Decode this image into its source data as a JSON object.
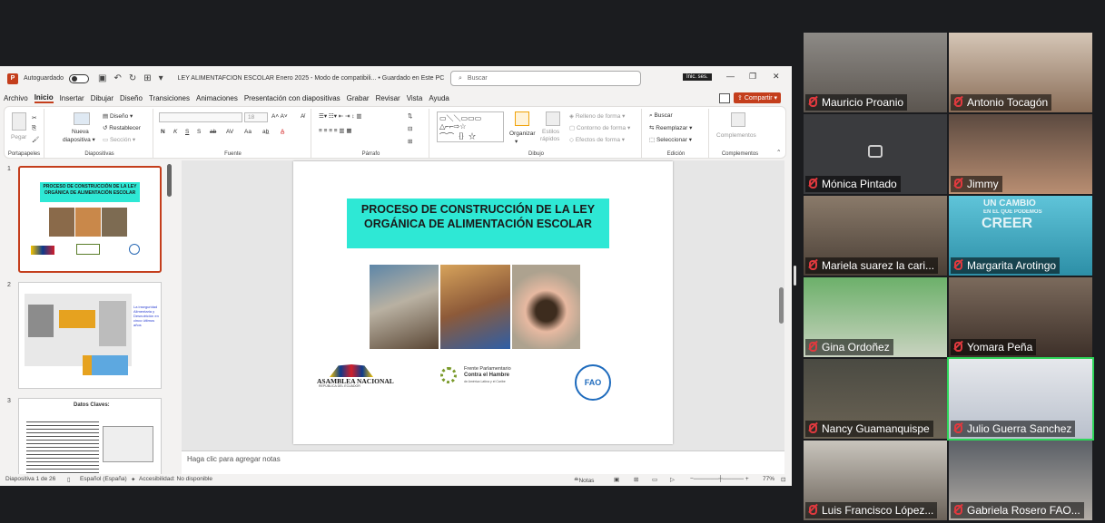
{
  "ppt": {
    "autosave_label": "Autoguardado",
    "doc_title": "LEY ALIMENTAFCION ESCOLAR Enero 2025  -  Modo de compatibili...  •  Guardado en Este PC",
    "search_placeholder": "Buscar",
    "signin": "Inic. ses.",
    "share": "Compartir",
    "menu": [
      "Archivo",
      "Inicio",
      "Insertar",
      "Dibujar",
      "Diseño",
      "Transiciones",
      "Animaciones",
      "Presentación con diapositivas",
      "Grabar",
      "Revisar",
      "Vista",
      "Ayuda"
    ],
    "ribbon": {
      "paste": "Pegar",
      "portapapeles": "Portapapeles",
      "nueva": "Nueva",
      "diapositiva": "diapositiva",
      "diseno": "Diseño",
      "restablecer": "Restablecer",
      "seccion": "Sección",
      "diapositivas": "Diapositivas",
      "fuente": "Fuente",
      "parrafo": "Párrafo",
      "organizar": "Organizar",
      "estilos": "Estilos",
      "rapidos": "rápidos",
      "relleno": "Relleno de forma",
      "contorno": "Contorno de forma",
      "efectos": "Efectos de forma",
      "dibujo": "Dibujo",
      "buscar": "Buscar",
      "reemplazar": "Reemplazar",
      "seleccionar": "Seleccionar",
      "edicion": "Edición",
      "complementos": "Complementos",
      "font_size": "18"
    },
    "thumbnails": [
      {
        "num": "1",
        "title": "PROCESO DE CONSTRUCCIÓN DE LA LEY ORGÁNICA DE ALIMENTACIÓN ESCOLAR"
      },
      {
        "num": "2",
        "side_text": "La inseguridad Alimentaria y Desnutrición en cinco últimos años"
      },
      {
        "num": "3",
        "title": "Datos Claves:"
      }
    ],
    "slide": {
      "title": "PROCESO DE CONSTRUCCIÓN DE LA LEY ORGÁNICA DE ALIMENTACIÓN ESCOLAR",
      "logo_asamblea": "ASAMBLEA NACIONAL",
      "logo_asamblea_sub": "REPÚBLICA DEL ECUADOR",
      "logo_frente_1": "Frente Parlamentario",
      "logo_frente_2": "Contra el Hambre",
      "logo_frente_3": "de América Latina y el Caribe",
      "logo_fao": "FAO"
    },
    "notes_placeholder": "Haga clic para agregar notas",
    "status": {
      "slide": "Diapositiva 1 de 26",
      "lang": "Español (España)",
      "access": "Accesibilidad: No disponible",
      "notes": "Notas",
      "zoom": "77%"
    }
  },
  "participants": [
    {
      "name": "Mauricio Proanio"
    },
    {
      "name": "Antonio Tocagón"
    },
    {
      "name": "Mónica Pintado"
    },
    {
      "name": "Jimmy"
    },
    {
      "name": "Mariela suarez la cari..."
    },
    {
      "name": "Margarita Arotingo",
      "banner_1": "UN CAMBIO",
      "banner_2": "EN EL QUE PODEMOS",
      "banner_3": "CREER"
    },
    {
      "name": "Gina Ordoñez"
    },
    {
      "name": "Yomara Peña"
    },
    {
      "name": "Nancy Guamanquispe"
    },
    {
      "name": "Julio Guerra Sanchez"
    },
    {
      "name": "Luis Francisco López..."
    },
    {
      "name": "Gabriela Rosero FAO..."
    }
  ],
  "colors": {
    "accent": "#c43e1c",
    "title_fill": "#2ee8d5",
    "speaker": "#2fd65a",
    "mic_muted": "#e0393e"
  }
}
